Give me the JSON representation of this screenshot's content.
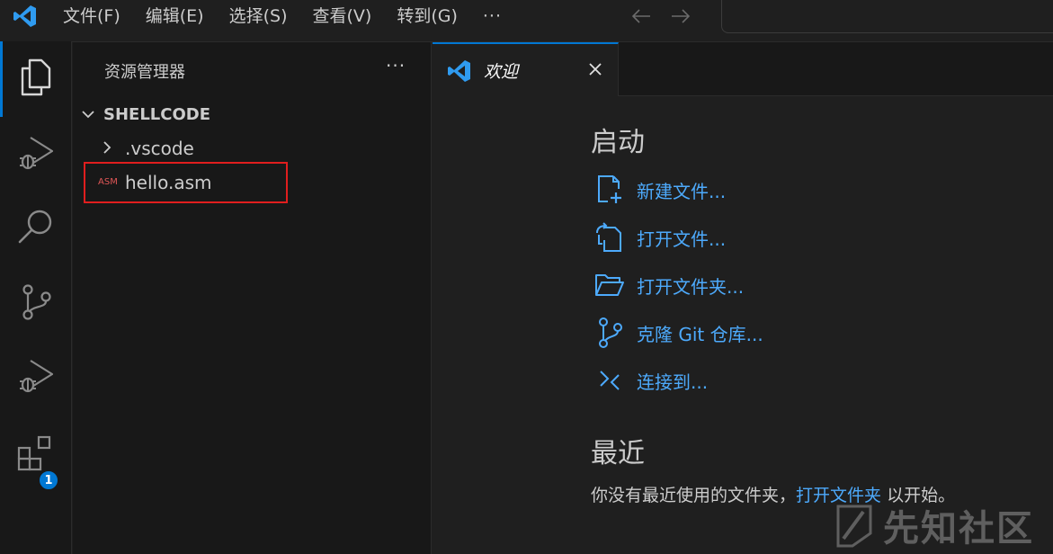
{
  "titlebar": {
    "menus": [
      "文件(F)",
      "编辑(E)",
      "选择(S)",
      "查看(V)",
      "转到(G)"
    ],
    "more": "···"
  },
  "activitybar": {
    "items": [
      "explorer-icon",
      "run-debug-icon",
      "search-icon",
      "source-control-icon",
      "run-debug-icon",
      "extensions-icon"
    ],
    "extensions_badge": "1"
  },
  "sidebar": {
    "title": "资源管理器",
    "more": "···",
    "folder": "SHELLCODE",
    "tree": [
      {
        "name": ".vscode",
        "type": "folder"
      },
      {
        "name": "hello.asm",
        "type": "file",
        "icon_label": "ASM"
      }
    ]
  },
  "tabs": [
    {
      "label": "欢迎",
      "active": true
    }
  ],
  "welcome": {
    "start_title": "启动",
    "actions": [
      {
        "label": "新建文件...",
        "icon": "new-file-icon"
      },
      {
        "label": "打开文件...",
        "icon": "open-file-icon"
      },
      {
        "label": "打开文件夹...",
        "icon": "open-folder-icon"
      },
      {
        "label": "克隆 Git 仓库...",
        "icon": "git-clone-icon"
      },
      {
        "label": "连接到...",
        "icon": "remote-connect-icon"
      }
    ],
    "recent_title": "最近",
    "recent_prefix": "你没有最近使用的文件夹，",
    "recent_link": "打开文件夹",
    "recent_suffix": " 以开始。"
  },
  "watermark": "先知社区",
  "colors": {
    "accent": "#0078d4",
    "link": "#4daafc",
    "highlight": "#e01e1e"
  }
}
